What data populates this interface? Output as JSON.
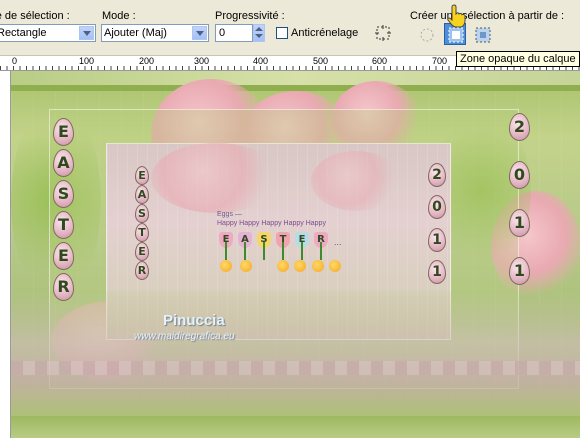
{
  "toolbar": {
    "selection_type_label": "Type de sélection :",
    "selection_type_value": "Rectangle",
    "mode_label": "Mode :",
    "mode_value": "Ajouter (Maj)",
    "progressivity_label": "Progressivité :",
    "progressivity_value": "0",
    "antialias_label": "Anticrénelage",
    "create_from_label": "Créer une sélection à partir de :",
    "tooltip": "Zone opaque du calque"
  },
  "ruler": {
    "labels": [
      "0",
      "100",
      "200",
      "300",
      "400",
      "500",
      "600",
      "700"
    ]
  },
  "canvas": {
    "left_eggs_big": [
      "E",
      "A",
      "S",
      "T",
      "E",
      "R"
    ],
    "left_eggs_small": [
      "E",
      "A",
      "S",
      "T",
      "E",
      "R"
    ],
    "right_eggs_inner": [
      "2",
      "0",
      "1",
      "1"
    ],
    "right_eggs_outer": [
      "2",
      "0",
      "1",
      "1"
    ],
    "center_title_small": "Eggs —",
    "happy_line": "Happy Happy Happy Happy Happy",
    "tulip_letters": [
      "E",
      "A",
      "S",
      "T",
      "E",
      "R",
      "..."
    ],
    "signature": "Pinuccia",
    "website": "www.maidiregrafica.eu"
  },
  "colors": {
    "canvas_green": "#a7c16a",
    "rose_pink": "#e9a9b1",
    "tooltip_bg": "#ffffe1",
    "active_button": "#4f8ed8"
  }
}
